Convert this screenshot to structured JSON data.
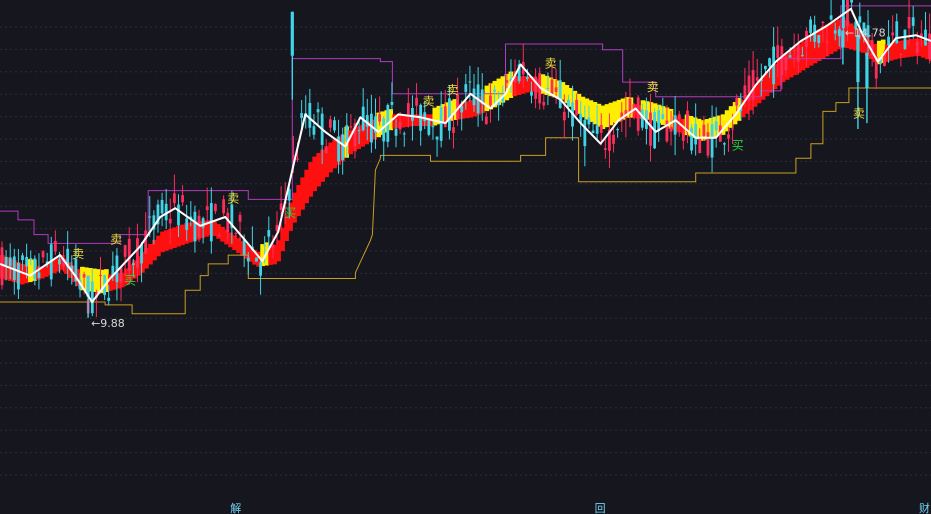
{
  "colors": {
    "background": "#16161e",
    "grid": "#2c2c3c",
    "up_candle": "#ff2d5a",
    "down_candle": "#3fd5e6",
    "ribbon_bull": "#ff1010",
    "ribbon_bear": "#ffee00",
    "white_line": "#ffffff",
    "upper_channel": "#b03cc0",
    "lower_channel": "#c8a020",
    "buy_text": "#27d43c",
    "sell_text": "#f0e040"
  },
  "annotations": {
    "low_label": "9.88",
    "high_label": "14.78",
    "sell_glyph": "卖",
    "buy_glyph": "买",
    "bottom_marks": [
      "解",
      "回",
      "财"
    ]
  },
  "chart_data": {
    "type": "candlestick",
    "title": "",
    "xlabel": "",
    "ylabel": "",
    "ylim": [
      7.2,
      15.3
    ],
    "grid": "horizontal dashed",
    "price_labels": [
      {
        "text": "9.88",
        "value": 9.88,
        "bar": 88
      },
      {
        "text": "14.78",
        "value": 14.78,
        "bar": 842
      }
    ],
    "bars": 930,
    "ribbon_values": [
      [
        0,
        10.9,
        10.6
      ],
      [
        20,
        10.75,
        10.5
      ],
      [
        40,
        10.7,
        10.6
      ],
      [
        60,
        10.9,
        10.75
      ],
      [
        80,
        10.6,
        10.4
      ],
      [
        100,
        10.55,
        10.35
      ],
      [
        120,
        10.6,
        10.45
      ],
      [
        140,
        10.95,
        10.7
      ],
      [
        160,
        11.3,
        11.05
      ],
      [
        185,
        11.45,
        11.2
      ],
      [
        210,
        11.5,
        11.35
      ],
      [
        235,
        11.2,
        11.05
      ],
      [
        255,
        10.95,
        10.8
      ],
      [
        275,
        11.1,
        10.85
      ],
      [
        290,
        11.9,
        11.5
      ],
      [
        310,
        12.55,
        12.05
      ],
      [
        330,
        12.85,
        12.45
      ],
      [
        350,
        13.05,
        12.75
      ],
      [
        370,
        13.2,
        12.95
      ],
      [
        390,
        13.3,
        13.15
      ],
      [
        410,
        13.3,
        13.2
      ],
      [
        430,
        13.3,
        13.2
      ],
      [
        450,
        13.45,
        13.3
      ],
      [
        470,
        13.55,
        13.35
      ],
      [
        490,
        13.75,
        13.5
      ],
      [
        510,
        13.95,
        13.7
      ],
      [
        530,
        13.95,
        13.8
      ],
      [
        560,
        13.75,
        13.65
      ],
      [
        580,
        13.5,
        13.35
      ],
      [
        600,
        13.35,
        13.15
      ],
      [
        625,
        13.5,
        13.35
      ],
      [
        650,
        13.4,
        13.3
      ],
      [
        675,
        13.25,
        13.1
      ],
      [
        700,
        13.1,
        12.95
      ],
      [
        720,
        13.2,
        13.05
      ],
      [
        740,
        13.55,
        13.35
      ],
      [
        760,
        13.95,
        13.65
      ],
      [
        780,
        14.3,
        13.95
      ],
      [
        800,
        14.55,
        14.15
      ],
      [
        820,
        14.8,
        14.35
      ],
      [
        840,
        14.95,
        14.55
      ],
      [
        860,
        14.7,
        14.45
      ],
      [
        875,
        14.45,
        14.25
      ],
      [
        895,
        14.55,
        14.35
      ],
      [
        915,
        14.6,
        14.4
      ],
      [
        930,
        14.5,
        14.3
      ]
    ],
    "white_line": [
      [
        0,
        10.8
      ],
      [
        30,
        10.6
      ],
      [
        60,
        10.95
      ],
      [
        75,
        10.6
      ],
      [
        92,
        10.15
      ],
      [
        110,
        10.55
      ],
      [
        140,
        11.1
      ],
      [
        160,
        11.6
      ],
      [
        175,
        11.75
      ],
      [
        200,
        11.45
      ],
      [
        225,
        11.6
      ],
      [
        245,
        11.2
      ],
      [
        262,
        10.85
      ],
      [
        278,
        11.35
      ],
      [
        292,
        12.4
      ],
      [
        305,
        13.35
      ],
      [
        325,
        13.05
      ],
      [
        345,
        12.8
      ],
      [
        360,
        13.3
      ],
      [
        378,
        13.05
      ],
      [
        398,
        13.35
      ],
      [
        420,
        13.3
      ],
      [
        445,
        13.2
      ],
      [
        470,
        13.7
      ],
      [
        490,
        13.45
      ],
      [
        505,
        13.7
      ],
      [
        520,
        14.2
      ],
      [
        540,
        13.8
      ],
      [
        560,
        13.6
      ],
      [
        580,
        13.2
      ],
      [
        600,
        12.85
      ],
      [
        618,
        13.25
      ],
      [
        635,
        13.45
      ],
      [
        655,
        13.05
      ],
      [
        675,
        13.25
      ],
      [
        695,
        12.95
      ],
      [
        715,
        12.95
      ],
      [
        735,
        13.35
      ],
      [
        755,
        13.85
      ],
      [
        775,
        14.25
      ],
      [
        800,
        14.6
      ],
      [
        825,
        14.85
      ],
      [
        850,
        15.15
      ],
      [
        862,
        14.7
      ],
      [
        877,
        14.25
      ],
      [
        895,
        14.65
      ],
      [
        915,
        14.7
      ],
      [
        930,
        14.6
      ]
    ],
    "upper_channel": [
      [
        0,
        11.7
      ],
      [
        18,
        11.7
      ],
      [
        18,
        11.55
      ],
      [
        34,
        11.55
      ],
      [
        34,
        11.3
      ],
      [
        48,
        11.3
      ],
      [
        48,
        11.15
      ],
      [
        120,
        11.15
      ],
      [
        120,
        11.3
      ],
      [
        148,
        11.3
      ],
      [
        148,
        12.05
      ],
      [
        248,
        12.05
      ],
      [
        248,
        11.9
      ],
      [
        292,
        11.9
      ],
      [
        292,
        14.3
      ],
      [
        380,
        14.3
      ],
      [
        380,
        14.25
      ],
      [
        392,
        14.25
      ],
      [
        392,
        13.7
      ],
      [
        505,
        13.7
      ],
      [
        505,
        14.55
      ],
      [
        602,
        14.55
      ],
      [
        602,
        14.45
      ],
      [
        622,
        14.45
      ],
      [
        622,
        13.9
      ],
      [
        655,
        13.9
      ],
      [
        655,
        13.65
      ],
      [
        760,
        13.65
      ],
      [
        760,
        13.75
      ],
      [
        780,
        13.75
      ],
      [
        780,
        14.3
      ],
      [
        840,
        14.3
      ],
      [
        840,
        15.2
      ],
      [
        931,
        15.2
      ]
    ],
    "lower_channel": [
      [
        0,
        10.15
      ],
      [
        105,
        10.15
      ],
      [
        105,
        10.1
      ],
      [
        132,
        10.1
      ],
      [
        132,
        9.95
      ],
      [
        185,
        9.95
      ],
      [
        185,
        10.35
      ],
      [
        200,
        10.35
      ],
      [
        200,
        10.6
      ],
      [
        208,
        10.6
      ],
      [
        208,
        10.8
      ],
      [
        228,
        10.8
      ],
      [
        228,
        10.95
      ],
      [
        248,
        10.95
      ],
      [
        248,
        10.55
      ],
      [
        355,
        10.55
      ],
      [
        355,
        10.65
      ],
      [
        370,
        11.2
      ],
      [
        372,
        11.3
      ],
      [
        375,
        12.4
      ],
      [
        380,
        12.6
      ],
      [
        380,
        12.65
      ],
      [
        430,
        12.65
      ],
      [
        430,
        12.55
      ],
      [
        520,
        12.55
      ],
      [
        520,
        12.65
      ],
      [
        545,
        12.65
      ],
      [
        545,
        12.95
      ],
      [
        578,
        12.95
      ],
      [
        578,
        12.2
      ],
      [
        695,
        12.2
      ],
      [
        695,
        12.35
      ],
      [
        795,
        12.35
      ],
      [
        795,
        12.6
      ],
      [
        810,
        12.6
      ],
      [
        810,
        12.85
      ],
      [
        822,
        12.85
      ],
      [
        822,
        13.4
      ],
      [
        835,
        13.4
      ],
      [
        835,
        13.55
      ],
      [
        848,
        13.55
      ],
      [
        848,
        13.8
      ],
      [
        931,
        13.8
      ]
    ],
    "signals": [
      {
        "type": "sell",
        "bar": 78,
        "value": 10.9
      },
      {
        "type": "sell",
        "bar": 116,
        "value": 11.15
      },
      {
        "type": "buy",
        "bar": 130,
        "value": 10.45
      },
      {
        "type": "sell",
        "bar": 233,
        "value": 11.85
      },
      {
        "type": "buy",
        "bar": 290,
        "value": 11.6
      },
      {
        "type": "sell",
        "bar": 428,
        "value": 13.5
      },
      {
        "type": "sell",
        "bar": 452,
        "value": 13.7
      },
      {
        "type": "sell",
        "bar": 550,
        "value": 14.15
      },
      {
        "type": "sell",
        "bar": 652,
        "value": 13.75
      },
      {
        "type": "buy",
        "bar": 737,
        "value": 12.75
      },
      {
        "type": "sell",
        "bar": 858,
        "value": 13.3
      }
    ],
    "bottom_marks": [
      {
        "text": "解",
        "bar": 236
      },
      {
        "text": "回",
        "bar": 600
      },
      {
        "text": "财",
        "bar": 925
      }
    ]
  }
}
